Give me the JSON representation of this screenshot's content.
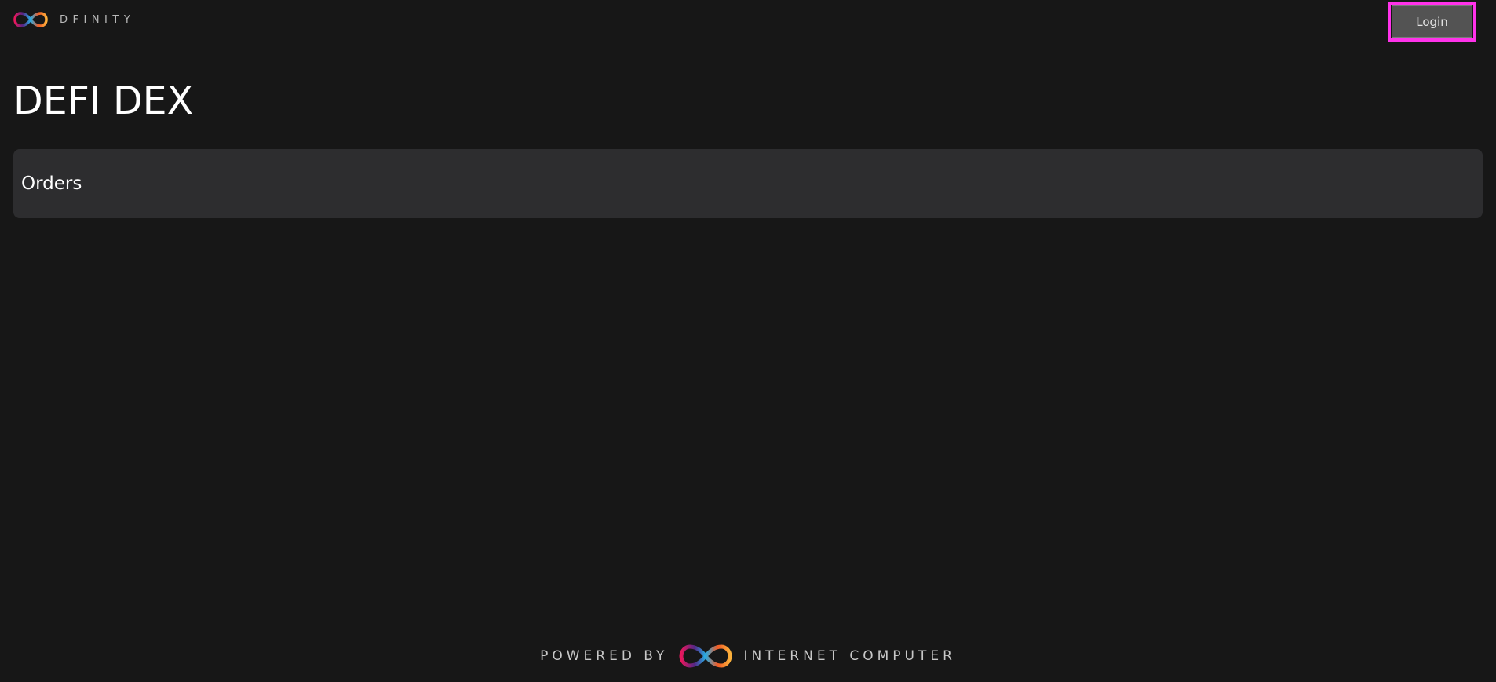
{
  "header": {
    "brand_name": "DFINITY",
    "login_label": "Login"
  },
  "main": {
    "title": "DEFI DEX",
    "orders_title": "Orders"
  },
  "footer": {
    "powered_by": "POWERED BY",
    "brand_name": "INTERNET COMPUTER"
  },
  "colors": {
    "background": "#171717",
    "panel": "#2d2d2f",
    "button": "#535353",
    "highlight": "#ff32ea",
    "logo_gradient_left": "#e8175d",
    "logo_gradient_right": "#f8a23a",
    "logo_blue": "#29abe2"
  },
  "icons": {
    "brand_logo": "infinity-logo",
    "footer_logo": "infinity-logo"
  }
}
